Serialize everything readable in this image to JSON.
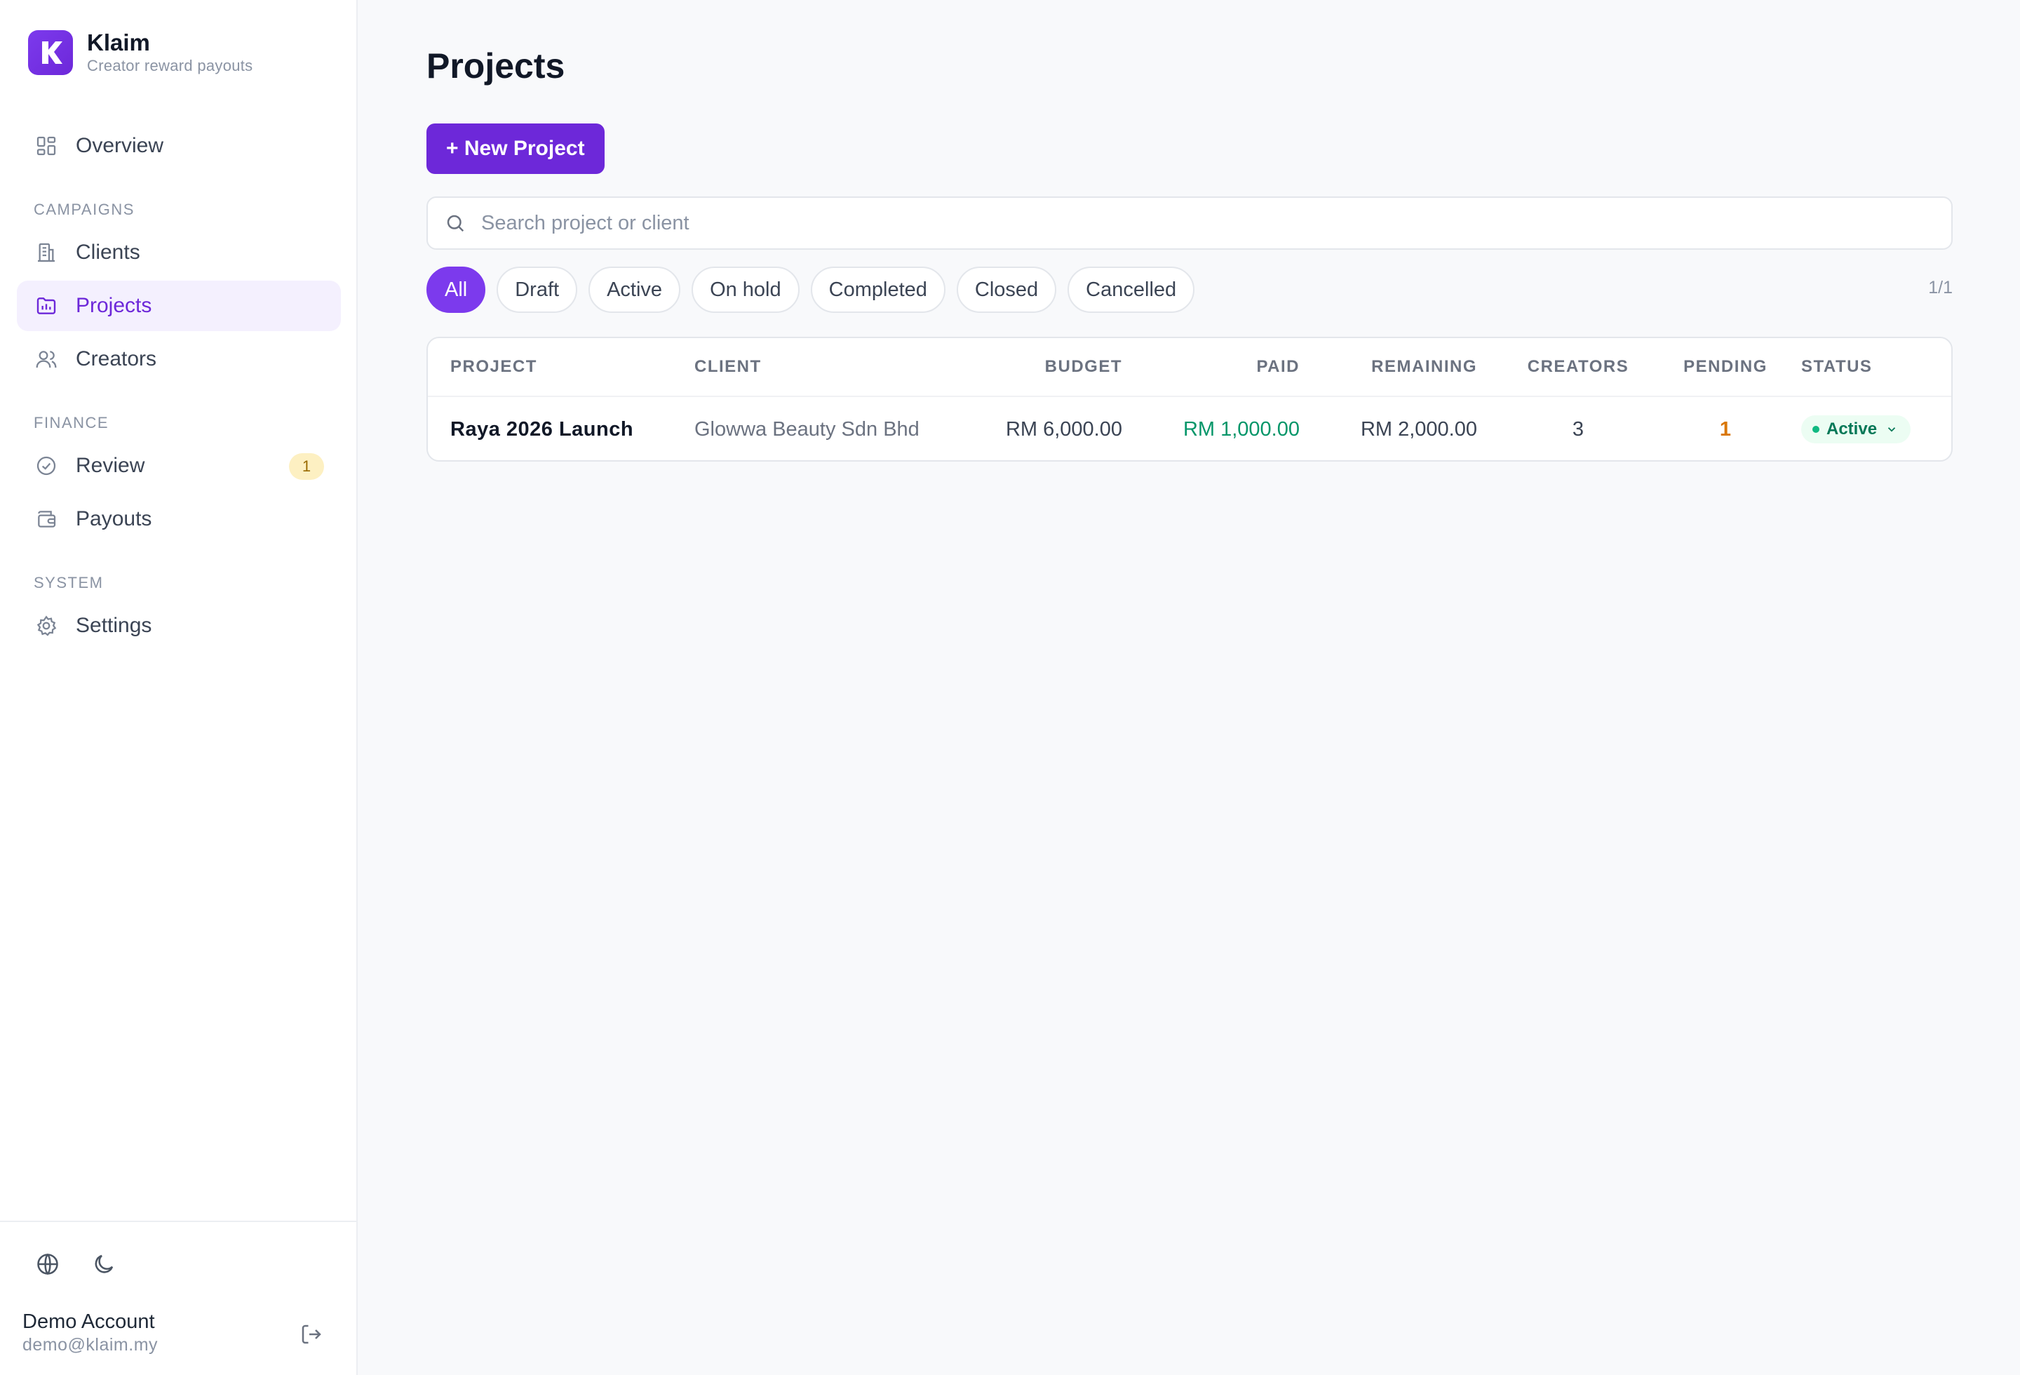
{
  "brand": {
    "name": "Klaim",
    "subtitle": "Creator reward payouts",
    "logo_letter": "K",
    "color": "#7c3aed"
  },
  "sidebar": {
    "overview": {
      "label": "Overview",
      "icon": "dashboard-icon"
    },
    "sections": {
      "campaigns": "CAMPAIGNS",
      "finance": "FINANCE",
      "system": "SYSTEM"
    },
    "items": {
      "clients": {
        "label": "Clients",
        "icon": "building-icon"
      },
      "projects": {
        "label": "Projects",
        "icon": "folder-chart-icon",
        "active": true
      },
      "creators": {
        "label": "Creators",
        "icon": "users-icon"
      },
      "review": {
        "label": "Review",
        "icon": "check-circle-icon",
        "badge": "1"
      },
      "payouts": {
        "label": "Payouts",
        "icon": "wallet-icon"
      },
      "settings": {
        "label": "Settings",
        "icon": "gear-icon"
      }
    },
    "footer": {
      "account_name": "Demo Account",
      "account_email": "demo@klaim.my"
    }
  },
  "main": {
    "title": "Projects",
    "new_button": "+ New Project",
    "search_placeholder": "Search project or client",
    "filters": [
      "All",
      "Draft",
      "Active",
      "On hold",
      "Completed",
      "Closed",
      "Cancelled"
    ],
    "active_filter": "All",
    "page_count": "1/1",
    "table": {
      "columns": [
        "PROJECT",
        "CLIENT",
        "BUDGET",
        "PAID",
        "REMAINING",
        "CREATORS",
        "PENDING",
        "STATUS"
      ],
      "rows": [
        {
          "project": "Raya 2026 Launch",
          "client": "Glowwa Beauty Sdn Bhd",
          "budget": "RM 6,000.00",
          "paid": "RM 1,000.00",
          "remaining": "RM 2,000.00",
          "creators": "3",
          "pending": "1",
          "status": "Active"
        }
      ]
    }
  },
  "colors": {
    "accent": "#6d28d9",
    "paid": "#059669",
    "pending": "#d97706",
    "status_active": "#047857"
  }
}
